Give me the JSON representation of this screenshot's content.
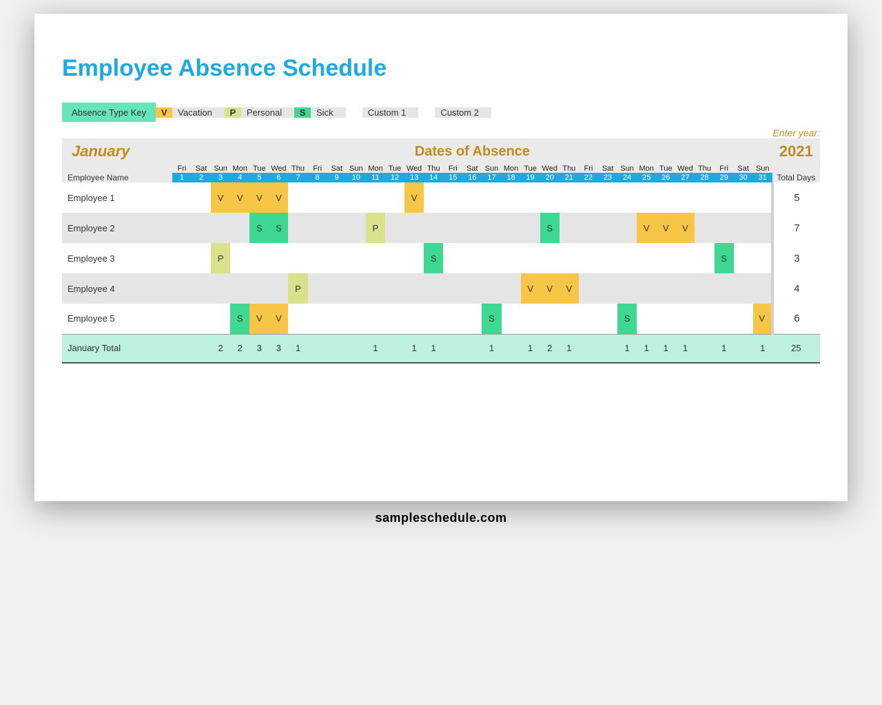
{
  "title": "Employee Absence Schedule",
  "legend": {
    "label": "Absence Type Key",
    "items": [
      {
        "code": "V",
        "text": "Vacation",
        "cls": "sw-v"
      },
      {
        "code": "P",
        "text": "Personal",
        "cls": "sw-p"
      },
      {
        "code": "S",
        "text": "Sick",
        "cls": "sw-s"
      },
      {
        "code": "",
        "text": "Custom 1",
        "cls": "sw-c1"
      },
      {
        "code": "",
        "text": "Custom 2",
        "cls": "sw-c2"
      }
    ]
  },
  "enter_year_label": "Enter year:",
  "month": "January",
  "dates_label": "Dates of Absence",
  "year": "2021",
  "name_header": "Employee Name",
  "total_header": "Total Days",
  "days": [
    "Fri",
    "Sat",
    "Sun",
    "Mon",
    "Tue",
    "Wed",
    "Thu",
    "Fri",
    "Sat",
    "Sun",
    "Mon",
    "Tue",
    "Wed",
    "Thu",
    "Fri",
    "Sat",
    "Sun",
    "Mon",
    "Tue",
    "Wed",
    "Thu",
    "Fri",
    "Sat",
    "Sun",
    "Mon",
    "Tue",
    "Wed",
    "Thu",
    "Fri",
    "Sat",
    "Sun"
  ],
  "nums": [
    "1",
    "2",
    "3",
    "4",
    "5",
    "6",
    "7",
    "8",
    "9",
    "10",
    "11",
    "12",
    "13",
    "14",
    "15",
    "16",
    "17",
    "18",
    "19",
    "20",
    "21",
    "22",
    "23",
    "24",
    "25",
    "26",
    "27",
    "28",
    "29",
    "30",
    "31"
  ],
  "employees": [
    {
      "name": "Employee 1",
      "total": "5",
      "cells": [
        "",
        "",
        "V",
        "V",
        "V",
        "V",
        "",
        "",
        "",
        "",
        "",
        "",
        "V",
        "",
        "",
        "",
        "",
        "",
        "",
        "",
        "",
        "",
        "",
        "",
        "",
        "",
        "",
        "",
        "",
        "",
        ""
      ]
    },
    {
      "name": "Employee 2",
      "total": "7",
      "cells": [
        "",
        "",
        "",
        "",
        "S",
        "S",
        "",
        "",
        "",
        "",
        "P",
        "",
        "",
        "",
        "",
        "",
        "",
        "",
        "",
        "S",
        "",
        "",
        "",
        "",
        "V",
        "V",
        "V",
        "",
        "",
        "",
        ""
      ]
    },
    {
      "name": "Employee 3",
      "total": "3",
      "cells": [
        "",
        "",
        "P",
        "",
        "",
        "",
        "",
        "",
        "",
        "",
        "",
        "",
        "",
        "S",
        "",
        "",
        "",
        "",
        "",
        "",
        "",
        "",
        "",
        "",
        "",
        "",
        "",
        "",
        "S",
        "",
        ""
      ]
    },
    {
      "name": "Employee 4",
      "total": "4",
      "cells": [
        "",
        "",
        "",
        "",
        "",
        "",
        "P",
        "",
        "",
        "",
        "",
        "",
        "",
        "",
        "",
        "",
        "",
        "",
        "V",
        "V",
        "V",
        "",
        "",
        "",
        "",
        "",
        "",
        "",
        "",
        "",
        ""
      ]
    },
    {
      "name": "Employee 5",
      "total": "6",
      "cells": [
        "",
        "",
        "",
        "S",
        "V",
        "V",
        "",
        "",
        "",
        "",
        "",
        "",
        "",
        "",
        "",
        "",
        "S",
        "",
        "",
        "",
        "",
        "",
        "",
        "S",
        "",
        "",
        "",
        "",
        "",
        "",
        "V"
      ]
    }
  ],
  "month_total_label": "January Total",
  "month_totals": [
    "",
    "",
    "2",
    "2",
    "3",
    "3",
    "1",
    "",
    "",
    "",
    "1",
    "",
    "1",
    "1",
    "",
    "",
    "1",
    "",
    "1",
    "2",
    "1",
    "",
    "",
    "1",
    "1",
    "1",
    "1",
    "",
    "1",
    "",
    "1"
  ],
  "grand_total": "25",
  "watermark": "sampleschedule.com",
  "chart_data": {
    "type": "table",
    "title": "Employee Absence Schedule — January 2021",
    "legend": {
      "V": "Vacation",
      "P": "Personal",
      "S": "Sick"
    },
    "rows": [
      {
        "employee": "Employee 1",
        "absences": {
          "3": "V",
          "4": "V",
          "5": "V",
          "6": "V",
          "13": "V"
        },
        "total": 5
      },
      {
        "employee": "Employee 2",
        "absences": {
          "5": "S",
          "6": "S",
          "11": "P",
          "20": "S",
          "25": "V",
          "26": "V",
          "27": "V"
        },
        "total": 7
      },
      {
        "employee": "Employee 3",
        "absences": {
          "3": "P",
          "14": "S",
          "29": "S"
        },
        "total": 3
      },
      {
        "employee": "Employee 4",
        "absences": {
          "7": "P",
          "19": "V",
          "20": "V",
          "21": "V"
        },
        "total": 4
      },
      {
        "employee": "Employee 5",
        "absences": {
          "4": "S",
          "5": "V",
          "6": "V",
          "17": "S",
          "24": "S",
          "31": "V"
        },
        "total": 6
      }
    ],
    "column_totals": {
      "3": 2,
      "4": 2,
      "5": 3,
      "6": 3,
      "7": 1,
      "11": 1,
      "13": 1,
      "14": 1,
      "17": 1,
      "19": 1,
      "20": 2,
      "21": 1,
      "24": 1,
      "25": 1,
      "26": 1,
      "27": 1,
      "29": 1,
      "31": 1
    },
    "grand_total": 25
  }
}
